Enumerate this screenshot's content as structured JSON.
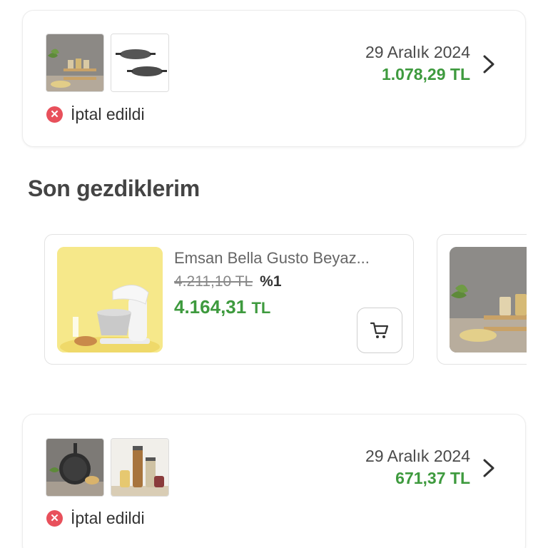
{
  "orders": [
    {
      "date": "29 Aralık 2024",
      "price": "1.078,29 TL",
      "status": "İptal edildi",
      "status_icon": "close-icon",
      "thumbnails": [
        "spice-rack-photo",
        "frying-pans-photo"
      ]
    },
    {
      "date": "29 Aralık 2024",
      "price": "671,37 TL",
      "status": "İptal edildi",
      "status_icon": "close-icon",
      "thumbnails": [
        "crepe-pan-photo",
        "storage-jars-photo"
      ]
    }
  ],
  "recently_viewed": {
    "title": "Son gezdiklerim",
    "products": [
      {
        "name": "Emsan Bella Gusto Beyaz...",
        "old_price": "4.211,10 TL",
        "discount": "%1",
        "new_price_amount": "4.164,31",
        "new_price_currency": "TL",
        "image": "stand-mixer-photo",
        "cart_icon": "cart-icon"
      },
      {
        "image": "spice-rack-photo"
      }
    ]
  },
  "colors": {
    "price_green": "#3e9a3e",
    "cancel_red": "#e8505b",
    "mixer_bg": "#f6e88a"
  }
}
